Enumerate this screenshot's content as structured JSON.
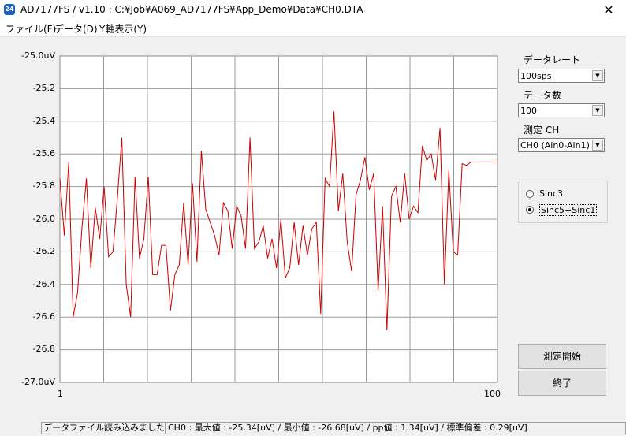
{
  "window": {
    "title": "AD7177FS / v1.10 : C:¥Job¥A069_AD7177FS¥App_Demo¥Data¥CH0.DTA",
    "app_icon_text": "24",
    "close_glyph": "✕"
  },
  "menu": [
    "ファイル(F)",
    "データ(D)",
    "Y軸表示(Y)"
  ],
  "sidebar": {
    "data_rate_label": "データレート",
    "data_rate_value": "100sps",
    "data_count_label": "データ数",
    "data_count_value": "100",
    "channel_label": "測定 CH",
    "channel_value": "CH0 (Ain0-Ain1)",
    "filter_options": [
      "Sinc3",
      "Sinc5+Sinc1"
    ],
    "filter_selected": 1,
    "start_button": "測定開始",
    "exit_button": "終了"
  },
  "status": {
    "message": "データファイル読み込みました",
    "stats": "CH0 : 最大値 : -25.34[uV] / 最小値 : -26.68[uV] / pp値 : 1.34[uV] / 標準偏差 : 0.29[uV]"
  },
  "chart_data": {
    "type": "line",
    "ylim": [
      -27.0,
      -25.0
    ],
    "y_ticks": [
      "-25.0uV",
      "-25.2",
      "-25.4",
      "-25.6",
      "-25.8",
      "-26.0",
      "-26.2",
      "-26.4",
      "-26.6",
      "-26.8",
      "-27.0uV"
    ],
    "x_ticks": [
      "1",
      "100"
    ],
    "xlim": [
      1,
      100
    ],
    "grid": true,
    "line_color": "#cc0000",
    "series": [
      {
        "x": [
          1,
          2,
          3,
          4,
          5,
          6,
          7,
          8,
          9,
          10,
          11,
          12,
          13,
          14,
          15,
          16,
          17,
          18,
          19,
          20,
          21,
          22,
          23,
          24,
          25,
          26,
          27,
          28,
          29,
          30,
          31,
          32,
          33,
          34,
          35,
          36,
          37,
          38,
          39,
          40,
          41,
          42,
          43,
          44,
          45,
          46,
          47,
          48,
          49,
          50,
          51,
          52,
          53,
          54,
          55,
          56,
          57,
          58,
          59,
          60,
          61,
          62,
          63,
          64,
          65,
          66,
          67,
          68,
          69,
          70,
          71,
          72,
          73,
          74,
          75,
          76,
          77,
          78,
          79,
          80,
          81,
          82,
          83,
          84,
          85,
          86,
          87,
          88,
          89,
          90,
          91,
          92,
          93,
          94,
          95,
          96,
          97,
          98,
          99,
          100
        ],
        "values": [
          -25.75,
          -26.1,
          -25.65,
          -26.6,
          -26.45,
          -26.05,
          -25.75,
          -26.3,
          -25.93,
          -26.12,
          -25.8,
          -26.23,
          -26.2,
          -25.87,
          -25.5,
          -26.4,
          -26.6,
          -25.74,
          -26.24,
          -26.12,
          -25.74,
          -26.34,
          -26.34,
          -26.16,
          -26.16,
          -26.56,
          -26.34,
          -26.28,
          -25.9,
          -26.28,
          -25.78,
          -26.26,
          -25.58,
          -25.94,
          -26.02,
          -26.1,
          -26.22,
          -25.9,
          -25.95,
          -26.18,
          -25.92,
          -25.98,
          -26.18,
          -25.5,
          -26.18,
          -26.14,
          -26.04,
          -26.24,
          -26.12,
          -26.3,
          -26.0,
          -26.36,
          -26.3,
          -26.02,
          -26.28,
          -26.04,
          -26.22,
          -26.06,
          -26.02,
          -26.58,
          -25.75,
          -25.8,
          -25.34,
          -25.95,
          -25.72,
          -26.14,
          -26.32,
          -25.85,
          -25.76,
          -25.62,
          -25.82,
          -25.72,
          -26.44,
          -25.92,
          -26.68,
          -25.86,
          -25.8,
          -26.02,
          -25.72,
          -26.0,
          -25.92,
          -25.96,
          -25.55,
          -25.64,
          -25.6,
          -25.76,
          -25.44,
          -26.4,
          -25.7,
          -26.2,
          -26.22,
          -25.66,
          -25.67,
          -25.65,
          -25.65,
          -25.65,
          -25.65,
          -25.65,
          -25.65,
          -25.65
        ]
      }
    ]
  }
}
